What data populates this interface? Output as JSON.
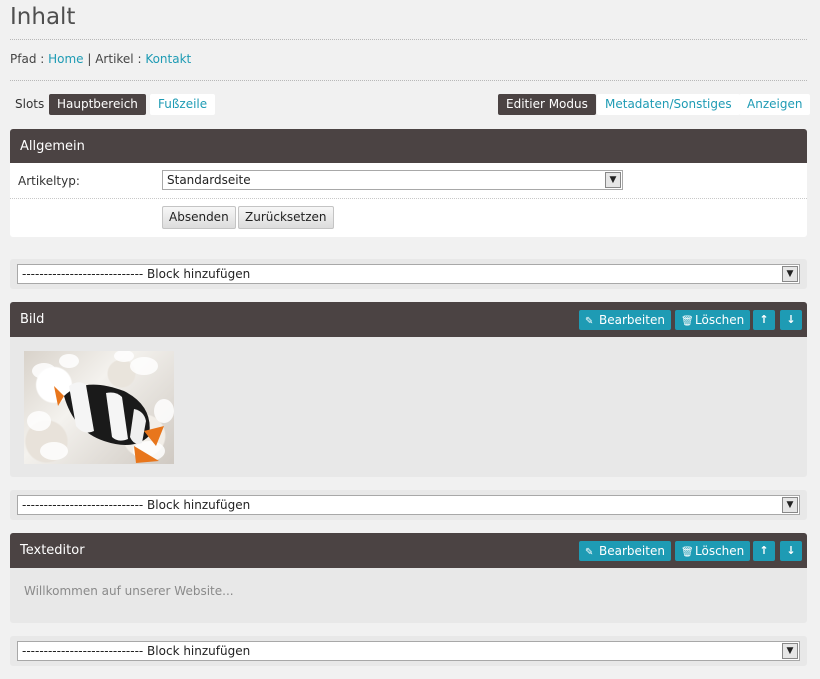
{
  "page": {
    "title": "Inhalt"
  },
  "breadcrumb": {
    "prefix": "Pfad : ",
    "home": "Home",
    "sep1": " | ",
    "artikel_label": "Artikel : ",
    "current": "Kontakt"
  },
  "slots": {
    "label": "Slots",
    "tabs": [
      "Hauptbereich",
      "Fußzeile"
    ],
    "active": "Hauptbereich"
  },
  "modes": {
    "items": [
      "Editier Modus",
      "Metadaten/Sonstiges",
      "Anzeigen"
    ],
    "active": "Editier Modus"
  },
  "allgemein": {
    "title": "Allgemein",
    "artikeltyp_label": "Artikeltyp:",
    "artikeltyp_value": "Standardseite",
    "submit_label": "Absenden",
    "reset_label": "Zurücksetzen"
  },
  "add_block": {
    "label": "---------------------------- Block hinzufügen"
  },
  "blocks": [
    {
      "title": "Bild",
      "edit_label": "Bearbeiten",
      "delete_label": "Löschen",
      "image_desc": "clownfish-in-anemone"
    },
    {
      "title": "Texteditor",
      "edit_label": "Bearbeiten",
      "delete_label": "Löschen",
      "content": "Willkommen auf unserer Website..."
    }
  ],
  "colors": {
    "header_bg": "#4b4343",
    "accent": "#1e9bb4",
    "panel_bg": "#e8e8e8",
    "page_bg": "#f1f1f1"
  },
  "icons": {
    "edit": "pencil-icon",
    "delete": "trash-icon",
    "up": "arrow-up-icon",
    "down": "arrow-down-icon",
    "dropdown": "chevron-down-icon"
  }
}
